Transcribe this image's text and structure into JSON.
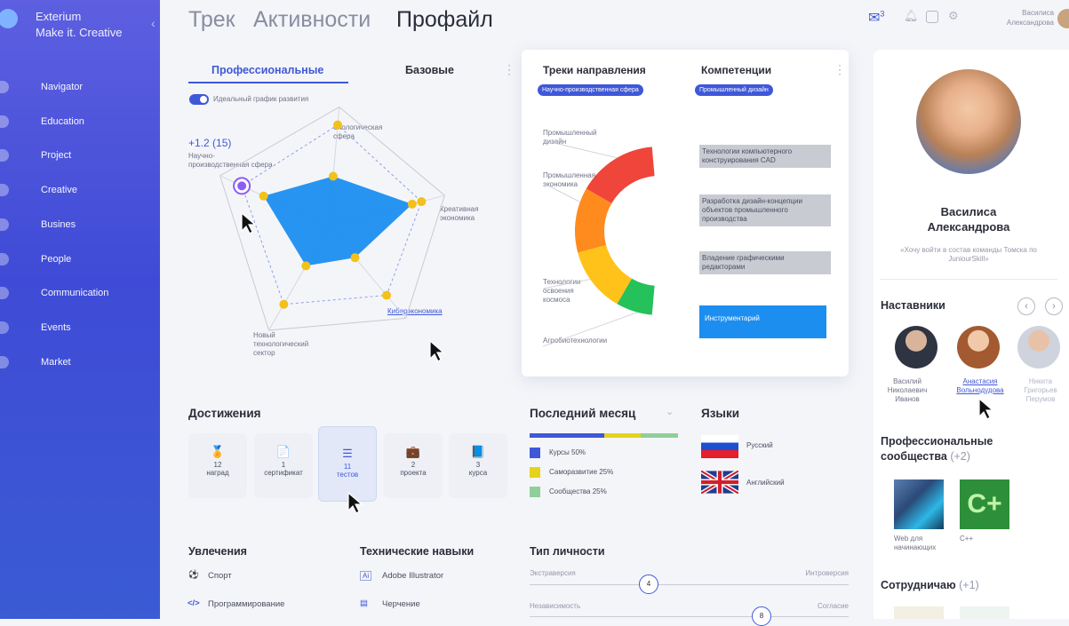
{
  "brand": {
    "name": "Exterium",
    "tagline": "Make it. Creative"
  },
  "nav": [
    "Navigator",
    "Education",
    "Project",
    "Creative",
    "Busines",
    "People",
    "Communication",
    "Events",
    "Market"
  ],
  "tabs": [
    "Трек",
    "Активности",
    "Профайл"
  ],
  "top": {
    "mail_count": "3",
    "user_first": "Василиса",
    "user_last": "Александрова"
  },
  "radar": {
    "tabs": [
      "Профессиональные",
      "Базовые"
    ],
    "toggle_label": "Идеальный график развития",
    "score": "+1.2 (15)",
    "axes": [
      "Научно-производственная сфера",
      "Экологическая сфера",
      "Креативная экономика",
      "Киберэкономика",
      "Новый технологический сектор"
    ],
    "actual": [
      0.6,
      0.42,
      0.72,
      0.34,
      0.38
    ],
    "ideal": [
      0.8,
      0.85,
      0.8,
      0.75,
      0.75
    ],
    "accent": "#1c8ef0"
  },
  "tracks": {
    "title1": "Треки направления",
    "title2": "Компетенции",
    "pill1": "Научно-производственная сфера",
    "pill2": "Промышленный дизайн",
    "labels": [
      "Промышленный дизайн",
      "Промышленная экономика",
      "Технологии освоения космоса",
      "Агробиотехнологии"
    ],
    "competences": [
      "Технологии компьютерного конструирования CAD",
      "Разработка дизайн-концепции объектов промышленного производства",
      "Владение графическими редакторами",
      "Инструментарий"
    ],
    "segment_colors": [
      "#f0453a",
      "#ff8a1e",
      "#ffc21a",
      "#25c15a"
    ]
  },
  "achievements": {
    "title": "Достижения",
    "items": [
      {
        "count": "12",
        "label": "наград",
        "icon": "medal-icon",
        "glyph": "🏅"
      },
      {
        "count": "1",
        "label": "сертификат",
        "icon": "certificate-icon",
        "glyph": "📄"
      },
      {
        "count": "11",
        "label": "тестов",
        "icon": "list-icon",
        "glyph": "☰"
      },
      {
        "count": "2",
        "label": "проекта",
        "icon": "briefcase-icon",
        "glyph": "💼"
      },
      {
        "count": "3",
        "label": "курса",
        "icon": "book-icon",
        "glyph": "📘"
      }
    ]
  },
  "month": {
    "title": "Последний месяц",
    "items": [
      {
        "label": "Курсы 50%",
        "color": "#3f58d8"
      },
      {
        "label": "Саморазвитие 25%",
        "color": "#e6d21a"
      },
      {
        "label": "Сообщества 25%",
        "color": "#8ecf9a"
      }
    ],
    "shares": [
      0.5,
      0.25,
      0.25
    ]
  },
  "languages": {
    "title": "Языки",
    "items": [
      "Русский",
      "Английский"
    ]
  },
  "hobbies": {
    "title": "Увлечения",
    "items": [
      "Спорт",
      "Программирование"
    ],
    "icons": [
      "⚽",
      "</>"
    ]
  },
  "skills": {
    "title": "Технические навыки",
    "items": [
      "Adobe Illustrator",
      "Черчение"
    ],
    "icons": [
      "Ai",
      "▤"
    ]
  },
  "personality": {
    "title": "Тип личности",
    "row1": {
      "left": "Экстраверсия",
      "right": "Интроверсия",
      "value": "4"
    },
    "row2": {
      "left": "Независимость",
      "right": "Согласие",
      "value": "8"
    }
  },
  "profile": {
    "name1": "Василиса",
    "name2": "Александрова",
    "quote": "«Хочу войти в состав команды Томска по JuniourSkill»",
    "mentors_title": "Наставники",
    "mentors": [
      {
        "first": "Василий",
        "middle": "Николаевич",
        "last": "Иванов"
      },
      {
        "first": "Анастасия",
        "middle": "Вольнодудова",
        "last": ""
      },
      {
        "first": "Никита",
        "middle": "Григорьев",
        "last": "Перумов"
      }
    ],
    "communities_title": "Профессиональные сообщества",
    "communities_more": "(+2)",
    "communities": [
      "Web для начинающих",
      "C++"
    ],
    "cooperate_title": "Сотрудничаю",
    "cooperate_more": "(+1)"
  }
}
